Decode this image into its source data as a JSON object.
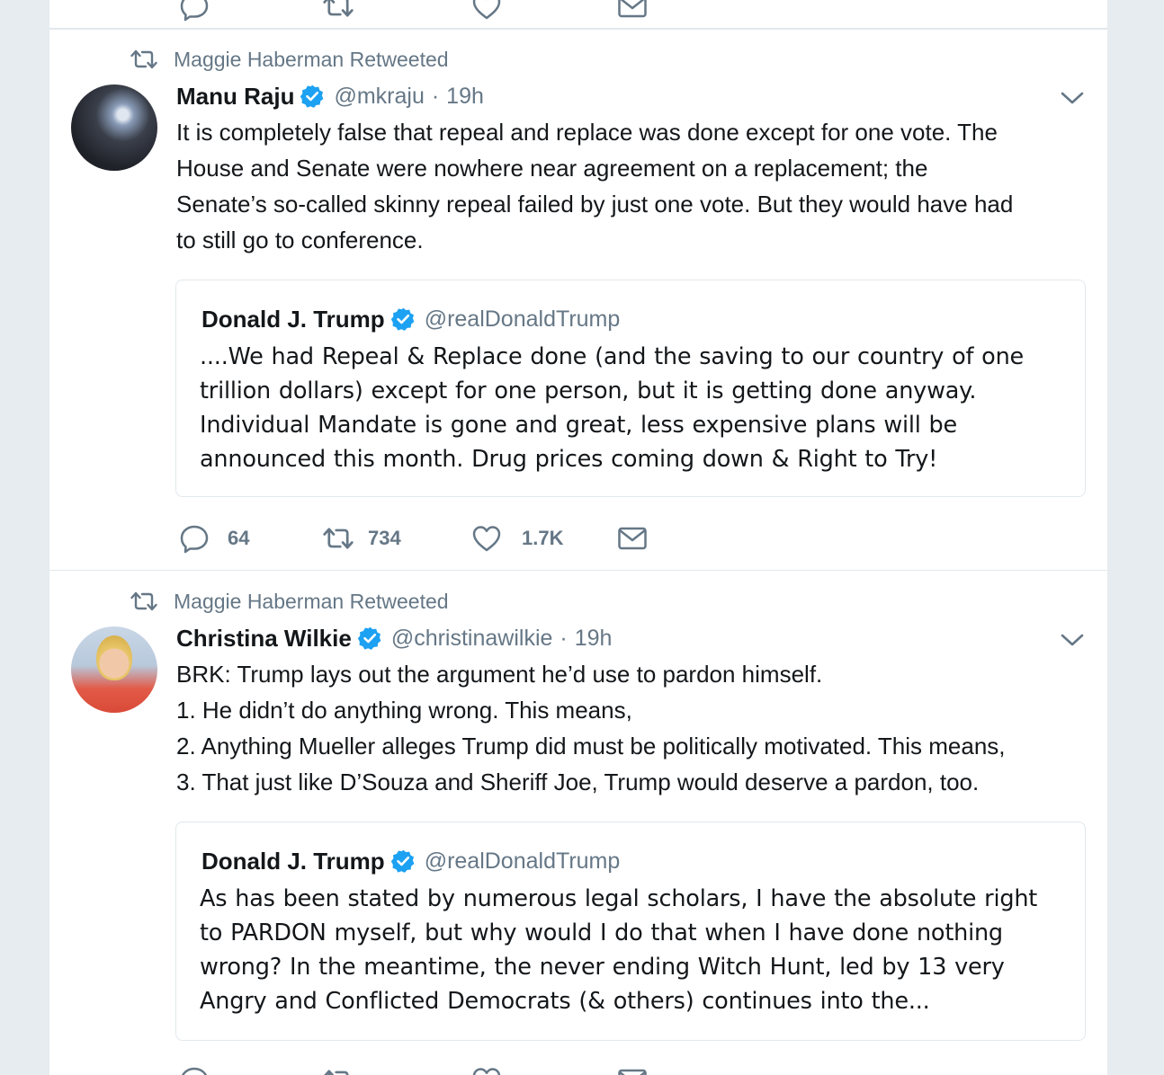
{
  "tweets": [
    {
      "context": "Maggie Haberman Retweeted",
      "author_name": "Manu Raju",
      "handle": "@mkraju",
      "separator": "·",
      "time": "19h",
      "text_lines": [
        "It is completely false that repeal and replace was done except for one vote. The",
        "House and Senate were nowhere near agreement on a replacement; the",
        "Senate’s so-called skinny repeal failed by just one vote. But they would have had",
        "to still go to conference."
      ],
      "quote": {
        "author_name": "Donald J. Trump",
        "handle": "@realDonaldTrump",
        "text_lines": [
          "....We had Repeal & Replace done (and the saving to our country of one",
          "trillion dollars) except for one person, but it is getting done anyway.",
          "Individual Mandate is gone and great, less expensive plans will be",
          "announced this month. Drug prices coming down & Right to Try!"
        ]
      },
      "replies": "64",
      "retweets": "734",
      "likes": "1.7K"
    },
    {
      "context": "Maggie Haberman Retweeted",
      "author_name": "Christina Wilkie",
      "handle": "@christinawilkie",
      "separator": "·",
      "time": "19h",
      "text_lines": [
        "BRK: Trump lays out the argument he’d use to pardon himself.",
        "1. He didn’t do anything wrong. This means,",
        "2. Anything Mueller alleges Trump did must be politically motivated. This means,",
        "3. That just like D’Souza and Sheriff Joe, Trump would deserve a pardon, too."
      ],
      "quote": {
        "author_name": "Donald J. Trump",
        "handle": "@realDonaldTrump",
        "text_lines": [
          "As has been stated by numerous legal scholars, I have the absolute right",
          "to PARDON myself, but why would I do that when I have done nothing",
          "wrong? In the meantime, the never ending Witch Hunt, led by 13 very",
          "Angry and Conflicted Democrats (& others) continues into the..."
        ]
      }
    }
  ],
  "icons": {
    "retweeted_context": "retweet-icon",
    "verified": "verified-badge-icon",
    "more": "chevron-down-icon",
    "reply": "reply-icon",
    "retweet": "retweet-icon",
    "like": "heart-icon",
    "message": "envelope-icon"
  },
  "colors": {
    "background": "#e6ecf0",
    "card": "#ffffff",
    "muted_text": "#657786",
    "verified_blue": "#1da1f2",
    "border": "#e1e8ed"
  }
}
